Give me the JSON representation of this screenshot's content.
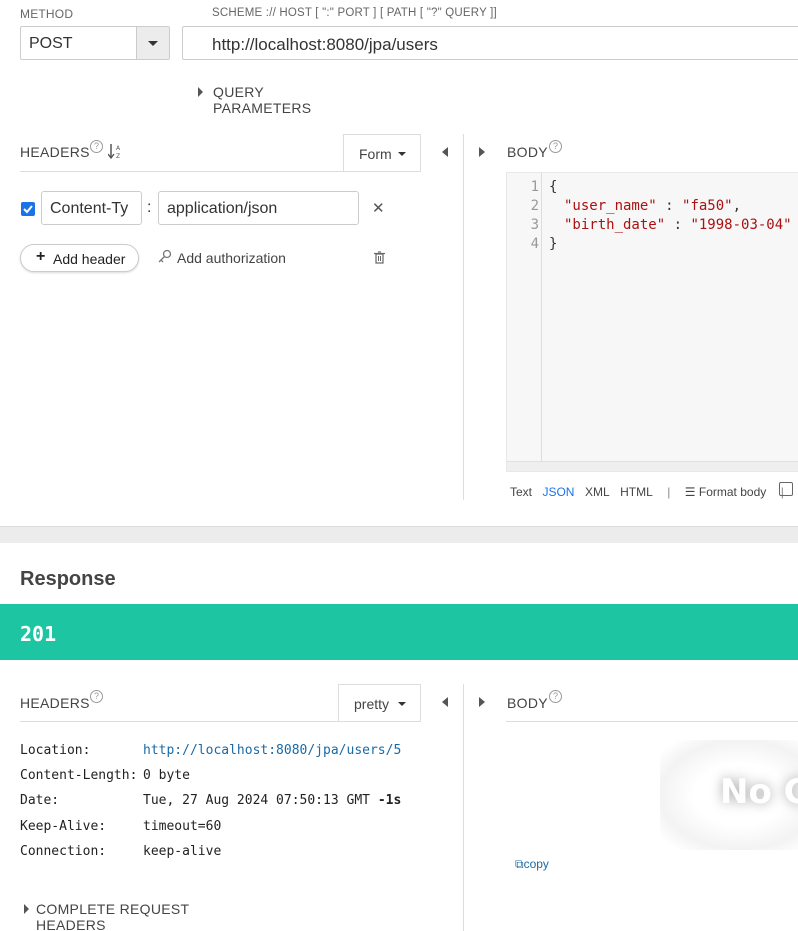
{
  "request": {
    "method_label": "METHOD",
    "method_value": "POST",
    "url_label": "SCHEME :// HOST [ \":\" PORT ] [ PATH [ \"?\" QUERY ]]",
    "url_value": "http://localhost:8080/jpa/users",
    "query_params_label": "QUERY PARAMETERS",
    "headers_label": "HEADERS",
    "headers_mode": "Form",
    "header_rows": [
      {
        "checked": true,
        "name": "Content-Ty",
        "separator": ":",
        "value": "application/json"
      }
    ],
    "add_header_label": "Add header",
    "add_authorization_label": "Add authorization",
    "body_label": "BODY",
    "body_lines": [
      {
        "num": "1",
        "text": "{"
      },
      {
        "num": "2",
        "key": "\"user_name\"",
        "sep": " : ",
        "val": "\"fa50\"",
        "tail": ","
      },
      {
        "num": "3",
        "key": "\"birth_date\"",
        "sep": " : ",
        "val": "\"1998-03-04\"",
        "tail": ""
      },
      {
        "num": "4",
        "text": "}"
      }
    ],
    "body_formats": [
      "Text",
      "JSON",
      "XML",
      "HTML"
    ],
    "active_format": "JSON",
    "format_body_label": "Format body"
  },
  "response": {
    "title": "Response",
    "status_code": "201",
    "status_color": "#1ec5a3",
    "headers_label": "HEADERS",
    "headers_mode": "pretty",
    "headers": [
      {
        "name": "Location:",
        "value": "http://localhost:8080/jpa/users/5",
        "is_link": true
      },
      {
        "name": "Content-Length:",
        "value": "0 byte"
      },
      {
        "name": "Date:",
        "value": "Tue, 27 Aug 2024 07:50:13 GMT",
        "suffix": "-1s"
      },
      {
        "name": "Keep-Alive:",
        "value": "timeout=60"
      },
      {
        "name": "Connection:",
        "value": "keep-alive"
      }
    ],
    "complete_request_headers_label": "COMPLETE REQUEST HEADERS",
    "body_label": "BODY",
    "no_content_text": "No C",
    "copy_label": "copy"
  },
  "icons": [
    "help-icon",
    "sort-az-icon",
    "caret-down-icon",
    "collapse-left-icon",
    "expand-right-icon",
    "close-icon",
    "plus-icon",
    "key-icon",
    "trash-icon",
    "format-icon",
    "copy-icon",
    "checkbox-icon"
  ]
}
